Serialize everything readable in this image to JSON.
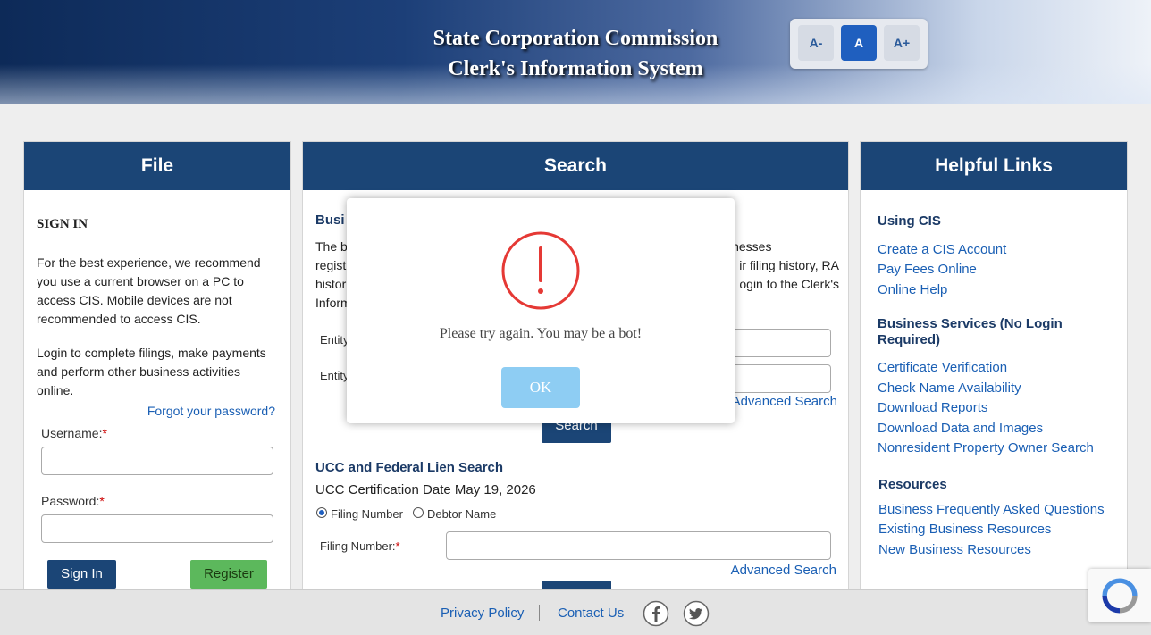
{
  "header": {
    "title_line1": "State Corporation Commission",
    "title_line2": "Clerk's Information System",
    "font_decrease": "A-",
    "font_normal": "A",
    "font_increase": "A+"
  },
  "file_panel": {
    "heading": "File",
    "signin_title": "SIGN IN",
    "recommend_text": "For the best experience, we recommend you use a current browser on a PC to access CIS. Mobile devices are not recommended to access CIS.",
    "login_text": "Login to complete filings, make payments and perform other business activities online.",
    "forgot_password": "Forgot your password?",
    "username_label": "Username:",
    "password_label": "Password:",
    "required_mark": "*",
    "signin_button": "Sign In",
    "register_button": "Register"
  },
  "search_panel": {
    "heading": "Search",
    "business_title_partial": "Busi",
    "intro_left": [
      "The b",
      "regist",
      "histor",
      "Inform"
    ],
    "intro_right": [
      "sinesses",
      "ir filing history, RA",
      "ogin to the Clerk's"
    ],
    "entity_label_1": "Entity",
    "entity_label_2": "Entity",
    "advanced_search": "Advanced Search",
    "search_button": "Search",
    "ucc_title": "UCC and Federal Lien Search",
    "ucc_date": "UCC Certification Date May 19, 2026",
    "radio_filing": "Filing Number",
    "radio_debtor": "Debtor Name",
    "filing_number_label": "Filing Number:",
    "required_mark": "*",
    "advanced_search_2": "Advanced Search"
  },
  "links_panel": {
    "heading": "Helpful Links",
    "using_cis_title": "Using CIS",
    "using_cis_links": [
      "Create a CIS Account",
      "Pay Fees Online",
      "Online Help"
    ],
    "business_title": "Business Services (No Login Required)",
    "business_links": [
      "Certificate Verification",
      "Check Name Availability",
      "Download Reports",
      "Download Data and Images",
      "Nonresident Property Owner Search"
    ],
    "resources_title": "Resources",
    "resources_links": [
      "Business Frequently Asked Questions",
      "Existing Business Resources",
      "New Business Resources"
    ]
  },
  "footer": {
    "privacy": "Privacy Policy",
    "contact": "Contact Us",
    "facebook_icon": "facebook-icon",
    "twitter_icon": "twitter-icon"
  },
  "modal": {
    "message": "Please try again. You may be a bot!",
    "ok_button": "OK",
    "icon": "exclamation-circle-icon"
  },
  "colors": {
    "panel_header": "#1b4576",
    "link": "#1a5fb4",
    "register_green": "#5cb85c",
    "modal_ok": "#8ecdf3",
    "alert_red": "#e53935"
  }
}
